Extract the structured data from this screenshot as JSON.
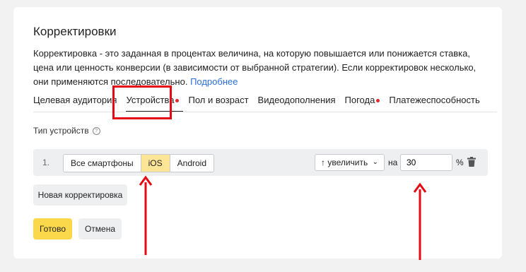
{
  "panel": {
    "title": "Корректировки",
    "description": "Корректировка - это заданная в процентах величина, на которую повышается или понижается ставка, цена или ценность конверсии (в зависимости от выбранной стратегии). Если корректировок несколько, они применяются последовательно.",
    "more_link": "Подробнее"
  },
  "tabs": [
    {
      "label": "Целевая аудитория",
      "dot": false,
      "active": false
    },
    {
      "label": "Устройства",
      "dot": true,
      "active": true
    },
    {
      "label": "Пол и возраст",
      "dot": false,
      "active": false
    },
    {
      "label": "Видеодополнения",
      "dot": false,
      "active": false
    },
    {
      "label": "Погода",
      "dot": true,
      "active": false
    },
    {
      "label": "Платежеспособность",
      "dot": false,
      "active": false
    }
  ],
  "device_type_label": "Тип устройств",
  "help_icon": "question-circle-icon",
  "adjustment_row": {
    "number": "1.",
    "segments": [
      "Все смартфоны",
      "iOS",
      "Android"
    ],
    "selected_segment": "iOS",
    "direction": "↑ увеличить",
    "on_label": "на",
    "value": "30",
    "percent": "%",
    "delete_icon": "trash-icon"
  },
  "buttons": {
    "new_adjustment": "Новая корректировка",
    "ready": "Готово",
    "cancel": "Отмена"
  },
  "colors": {
    "accent_yellow": "#fbd84a",
    "selected_segment": "#fde597",
    "link": "#2c6ed6",
    "annotation_red": "#e50914",
    "tab_dot": "#e8262b"
  }
}
